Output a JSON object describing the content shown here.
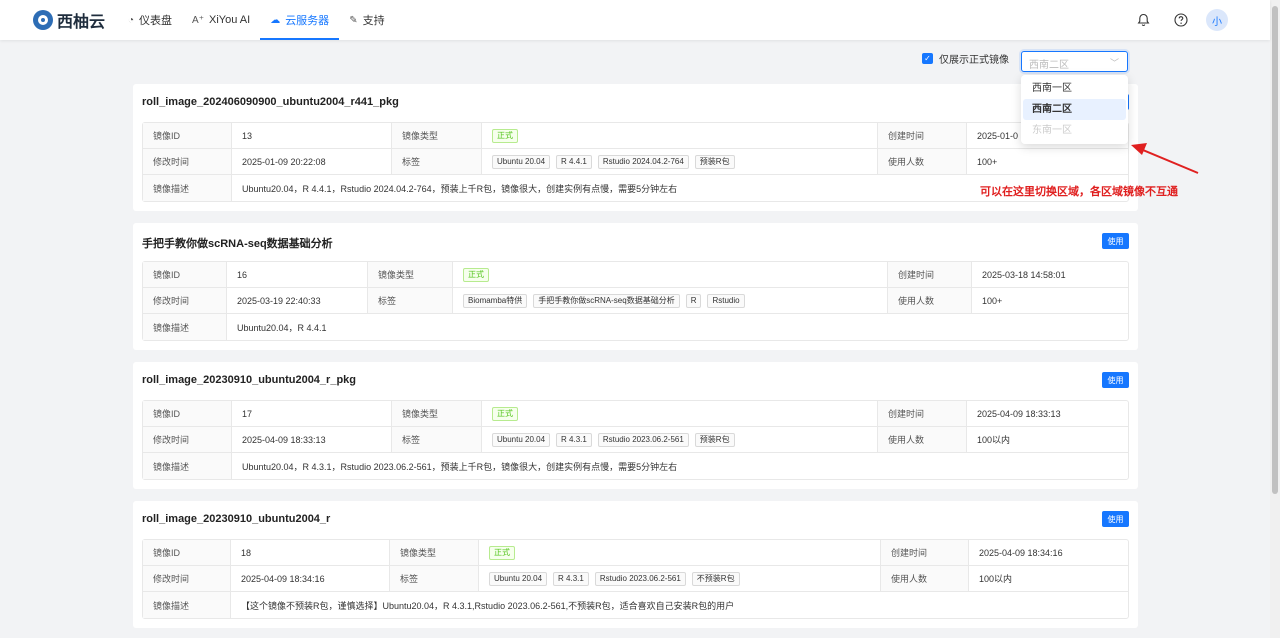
{
  "nav": {
    "brand": "西柚云",
    "items": [
      {
        "label": "仪表盘",
        "icon": "dashboard-icon"
      },
      {
        "label": "XiYou AI",
        "icon": "ai-sparkle-icon"
      },
      {
        "label": "云服务器",
        "icon": "cloud-icon",
        "active": true
      },
      {
        "label": "支持",
        "icon": "wrench-icon"
      }
    ],
    "avatar": "小"
  },
  "filter": {
    "checkbox_label": "仅展示正式镜像",
    "checked": true,
    "select_placeholder": "西南二区",
    "options": [
      {
        "label": "西南一区",
        "state": "normal"
      },
      {
        "label": "西南二区",
        "state": "selected"
      },
      {
        "label": "东南一区",
        "state": "disabled"
      }
    ]
  },
  "annotation": {
    "text": "可以在这里切换区域，各区域镜像不互通",
    "color": "#e02020"
  },
  "labels": {
    "image_id": "镜像ID",
    "image_type": "镜像类型",
    "created": "创建时间",
    "modified": "修改时间",
    "tags": "标签",
    "users": "使用人数",
    "desc": "镜像描述",
    "use": "使用"
  },
  "images": [
    {
      "title": "roll_image_202406090900_ubuntu2004_r441_pkg",
      "id": "13",
      "type": "正式",
      "created": "2025-01-0",
      "modified": "2025-01-09 20:22:08",
      "tags": [
        "Ubuntu 20.04",
        "R 4.4.1",
        "Rstudio 2024.04.2-764",
        "预装R包"
      ],
      "users": "100+",
      "desc": "Ubuntu20.04，R 4.4.1，Rstudio 2024.04.2-764，预装上千R包，镜像很大，创建实例有点慢，需要5分钟左右"
    },
    {
      "title": "手把手教你做scRNA-seq数据基础分析",
      "id": "16",
      "type": "正式",
      "created": "2025-03-18 14:58:01",
      "modified": "2025-03-19 22:40:33",
      "tags": [
        "Biomamba特供",
        "手把手教你做scRNA-seq数据基础分析",
        "R",
        "Rstudio"
      ],
      "users": "100+",
      "desc": "Ubuntu20.04，R 4.4.1"
    },
    {
      "title": "roll_image_20230910_ubuntu2004_r_pkg",
      "id": "17",
      "type": "正式",
      "created": "2025-04-09 18:33:13",
      "modified": "2025-04-09 18:33:13",
      "tags": [
        "Ubuntu 20.04",
        "R 4.3.1",
        "Rstudio 2023.06.2-561",
        "预装R包"
      ],
      "users": "100以内",
      "desc": "Ubuntu20.04，R 4.3.1，Rstudio 2023.06.2-561，预装上千R包，镜像很大，创建实例有点慢，需要5分钟左右"
    },
    {
      "title": "roll_image_20230910_ubuntu2004_r",
      "id": "18",
      "type": "正式",
      "created": "2025-04-09 18:34:16",
      "modified": "2025-04-09 18:34:16",
      "tags": [
        "Ubuntu 20.04",
        "R 4.3.1",
        "Rstudio 2023.06.2-561",
        "不预装R包"
      ],
      "users": "100以内",
      "desc": "【这个镜像不预装R包，谨慎选择】Ubuntu20.04，R 4.3.1,Rstudio 2023.06.2-561,不预装R包，适合喜欢自己安装R包的用户"
    }
  ]
}
